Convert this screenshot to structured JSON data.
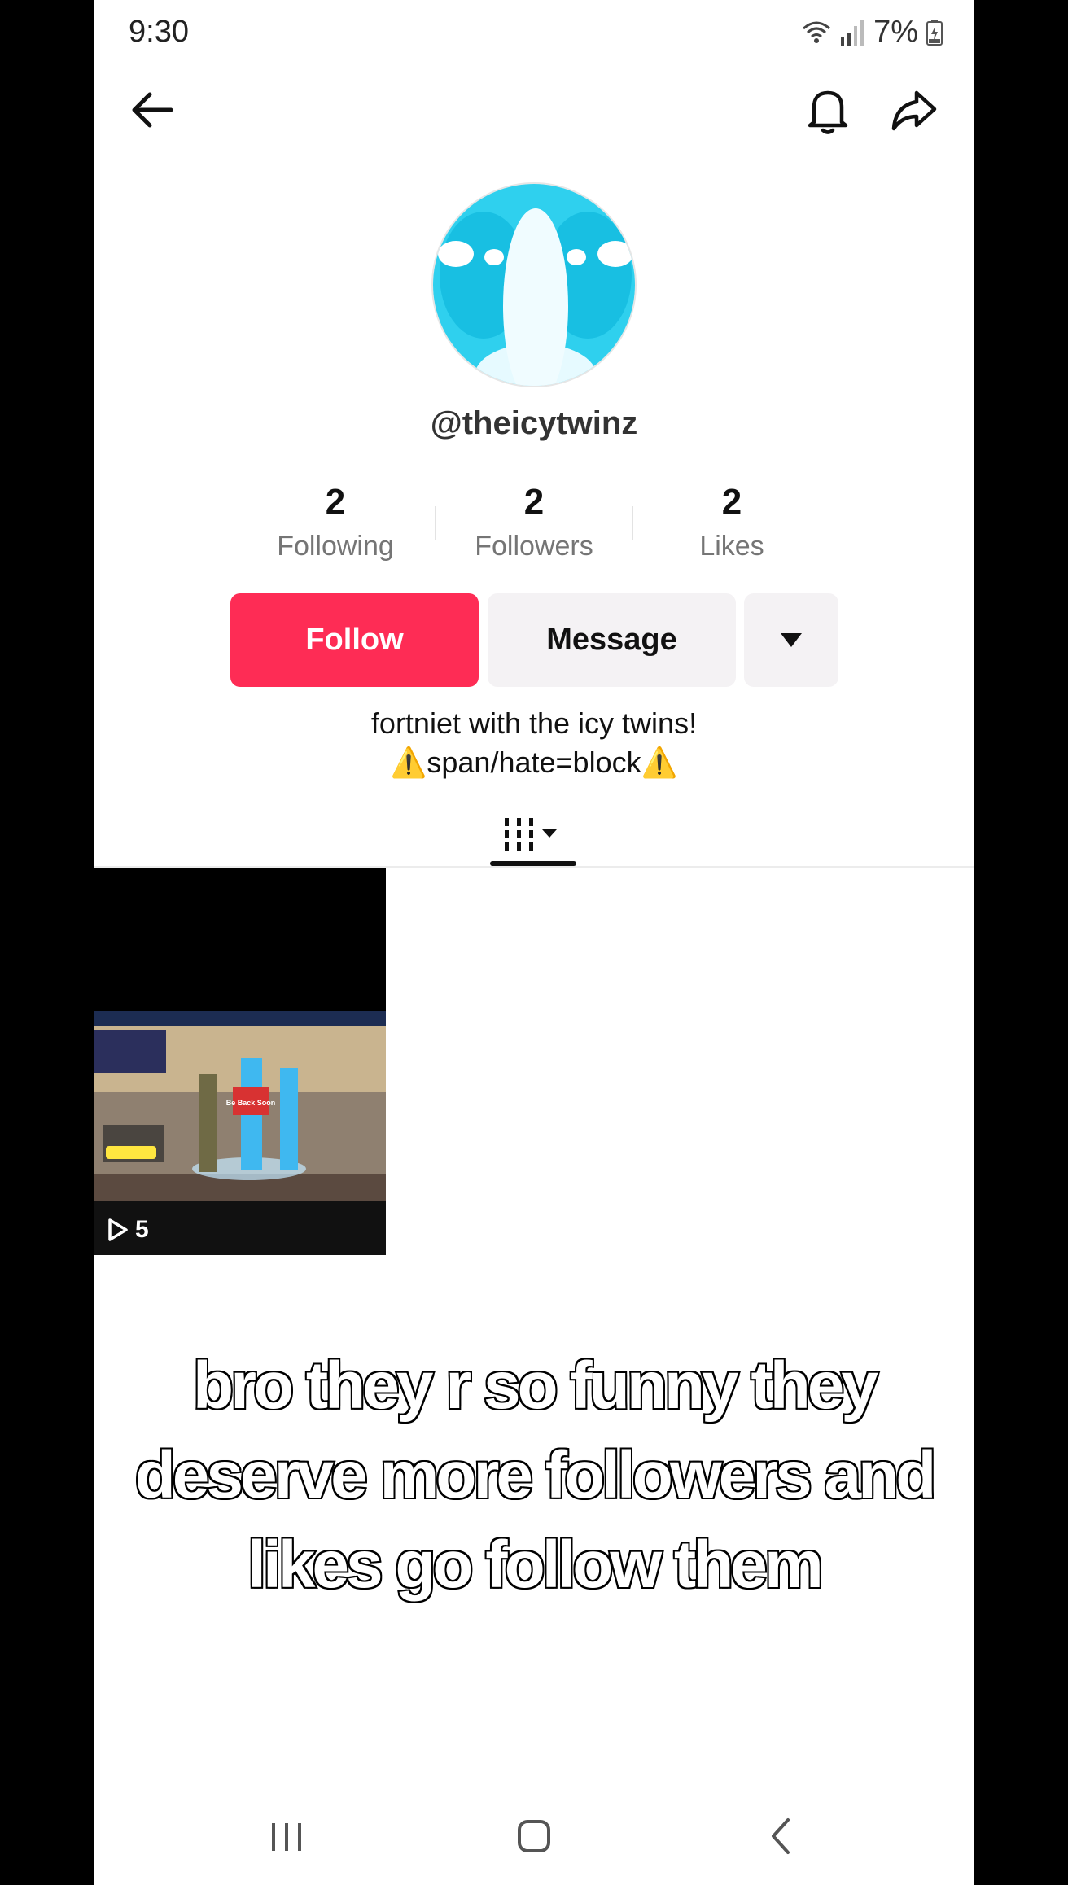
{
  "status_bar": {
    "time": "9:30",
    "battery": "7%"
  },
  "profile": {
    "username": "@theicytwinz",
    "stats": [
      {
        "value": "2",
        "label": "Following"
      },
      {
        "value": "2",
        "label": "Followers"
      },
      {
        "value": "2",
        "label": "Likes"
      }
    ],
    "bio": [
      "fortniet with the icy twins!",
      "span/hate=block"
    ],
    "colors": {
      "follow": "#fe2c55",
      "avatar": "#2fd0ee"
    }
  },
  "actions": {
    "follow_label": "Follow",
    "message_label": "Message"
  },
  "tabs": {
    "icon": "grid-icon"
  },
  "videos": [
    {
      "views": "5",
      "overlay_text": "Be Back Soon"
    }
  ],
  "caption": [
    "bro they r so funny they",
    "deserve more followers and",
    "likes go follow them"
  ]
}
